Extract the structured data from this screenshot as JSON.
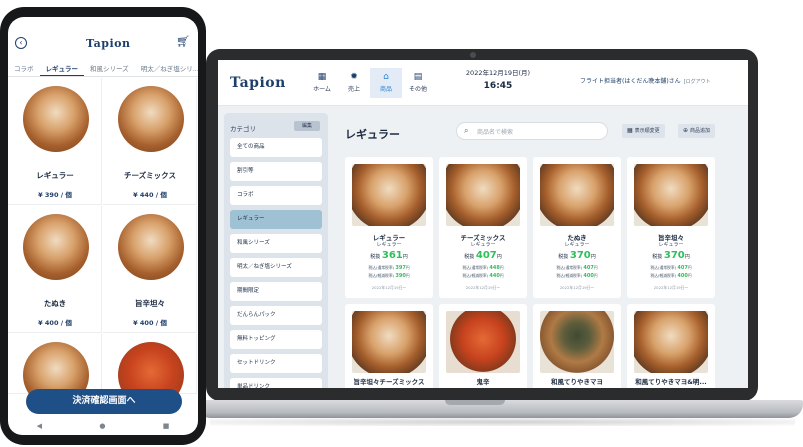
{
  "laptop": {
    "logo": "Tapion",
    "nav": [
      {
        "icon": "grid-icon",
        "glyph": "▦",
        "label": "ホーム"
      },
      {
        "icon": "gear-icon",
        "glyph": "✹",
        "label": "売上"
      },
      {
        "icon": "shop-icon",
        "glyph": "⌂",
        "label": "商品"
      },
      {
        "icon": "doc-icon",
        "glyph": "▤",
        "label": "その他"
      }
    ],
    "date": "2022年12月19日(月)",
    "time": "16:45",
    "user": "フライト担当者(はくだん晩本舗)さん",
    "logout": "[ログアウト",
    "category_title": "カテゴリ",
    "category_edit": "編集",
    "categories": [
      "全ての商品",
      "割引等",
      "コラボ",
      "レギュラー",
      "和風シリーズ",
      "明太／ねぎ塩シリーズ",
      "期間限定",
      "だんらんパック",
      "無料トッピング",
      "セットドリンク",
      "単品ドリンク"
    ],
    "active_category": 3,
    "main_title": "レギュラー",
    "search_placeholder": "商品名で検索",
    "btn_display": "表示順変更",
    "btn_add": "商品追加",
    "products": [
      {
        "name": "レギュラー",
        "category": "レギュラー",
        "price_prefix": "税抜",
        "price": "361",
        "price_unit": "円",
        "tax1_label": "税込(通常税率)",
        "tax1": "397",
        "tax2_label": "税込(軽減税率)",
        "tax2": "390",
        "tax_unit": "円",
        "date": "2022年12月19日～"
      },
      {
        "name": "チーズミックス",
        "category": "レギュラー",
        "price_prefix": "税抜",
        "price": "407",
        "price_unit": "円",
        "tax1_label": "税込(通常税率)",
        "tax1": "448",
        "tax2_label": "税込(軽減税率)",
        "tax2": "440",
        "tax_unit": "円",
        "date": "2022年12月19日～"
      },
      {
        "name": "たぬき",
        "category": "レギュラー",
        "price_prefix": "税抜",
        "price": "370",
        "price_unit": "円",
        "tax1_label": "税込(通常税率)",
        "tax1": "407",
        "tax2_label": "税込(軽減税率)",
        "tax2": "400",
        "tax_unit": "円",
        "date": "2022年12月19日～"
      },
      {
        "name": "旨辛坦々",
        "category": "レギュラー",
        "price_prefix": "税抜",
        "price": "370",
        "price_unit": "円",
        "tax1_label": "税込(通常税率)",
        "tax1": "407",
        "tax2_label": "税込(軽減税率)",
        "tax2": "400",
        "tax_unit": "円",
        "date": "2022年12月19日～"
      },
      {
        "name": "旨辛坦々チーズミックス"
      },
      {
        "name": "鬼辛"
      },
      {
        "name": "和風てりやきマヨ"
      },
      {
        "name": "和風てりやきマヨ&明..."
      }
    ]
  },
  "phone": {
    "logo": "Tapion",
    "tabs": [
      "コラボ",
      "レギュラー",
      "和風シリーズ",
      "明太／ねぎ塩シリ..."
    ],
    "active_tab": 1,
    "products": [
      {
        "name": "レギュラー",
        "price": "¥ 390 / 個"
      },
      {
        "name": "チーズミックス",
        "price": "¥ 440 / 個"
      },
      {
        "name": "たぬき",
        "price": "¥ 400 / 個"
      },
      {
        "name": "旨辛坦々",
        "price": "¥ 400 / 個"
      }
    ],
    "checkout_label": "決済確認画面へ",
    "sysnav": [
      "◀",
      "●",
      "■"
    ]
  },
  "colors": {
    "brand": "#1f3f6b",
    "price_green": "#2ebf5a",
    "active_category": "#9ec1d4",
    "checkout": "#1f4f87"
  }
}
